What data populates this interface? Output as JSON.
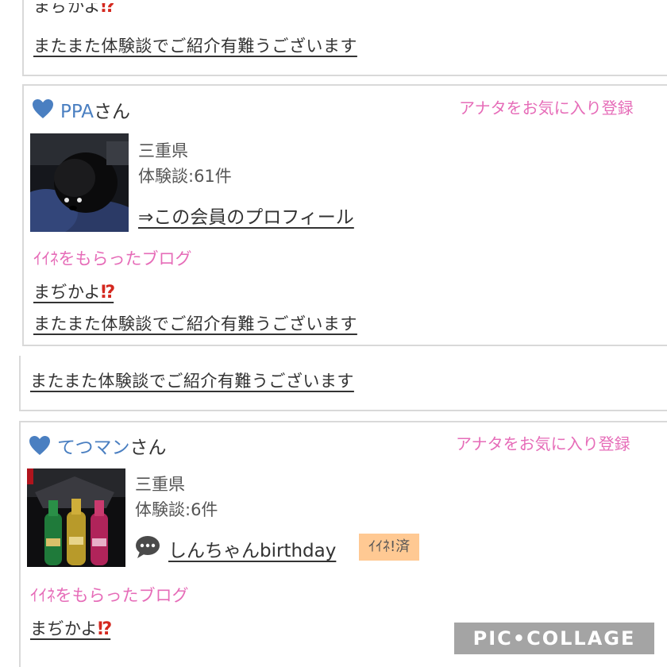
{
  "top": {
    "prev_card": {
      "blog_title_partial": "まぢかよ",
      "blog_title_emoji": "⁉",
      "review_link": "またまた体験談でご紹介有難うございます"
    },
    "member_card": {
      "name": "PPA",
      "suffix": "さん",
      "favorite_link": "アナタをお気に入り登録",
      "prefecture": "三重県",
      "review_count": "体験談:61件",
      "profile_link": "⇒この会員のプロフィール",
      "liked_blog_heading": "ｲｲﾈをもらったブログ",
      "blog_title": "まぢかよ",
      "blog_title_emoji": "⁉",
      "review_link": "またまた体験談でご紹介有難うございます"
    }
  },
  "bottom": {
    "prev_card": {
      "review_link": "またまた体験談でご紹介有難うございます"
    },
    "member_card": {
      "name": "てつマン",
      "suffix": "さん",
      "favorite_link": "アナタをお気に入り登録",
      "prefecture": "三重県",
      "review_count": "体験談:6件",
      "comment_link": "しんちゃんbirthday",
      "liked_badge": "ｲｲﾈ!済",
      "liked_blog_heading": "ｲｲﾈをもらったブログ",
      "blog_title": "まぢかよ",
      "blog_title_emoji": "⁉"
    }
  },
  "watermark": "PIC•COLLAGE",
  "colors": {
    "name_blue": "#4a7fc1",
    "pink_link": "#e66cb8",
    "badge_orange": "#ffc993",
    "border_gray": "#d9d9d9",
    "bang_red": "#d4281f"
  },
  "icons": {
    "heart": "heart-icon",
    "chat": "speech-bubble-icon"
  }
}
